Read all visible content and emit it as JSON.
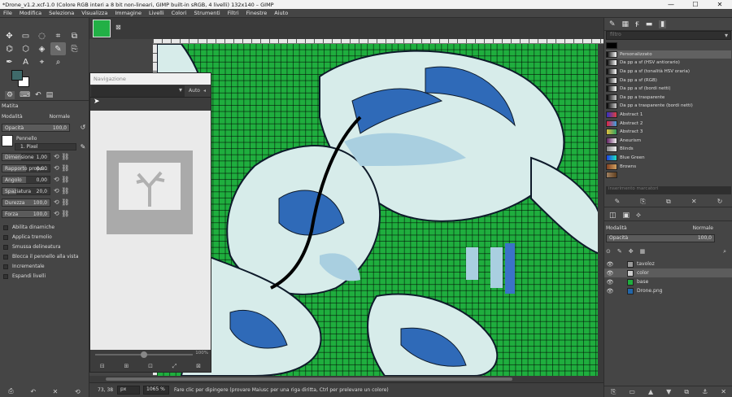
{
  "window": {
    "title": "*Drone_v1.2.xcf-1.0 (Colore RGB interi a 8 bit non-lineari, GIMP built-in sRGB, 4 livelli) 132x140 – GIMP",
    "minimize": "—",
    "maximize": "☐",
    "close": "✕"
  },
  "menu": [
    "File",
    "Modifica",
    "Seleziona",
    "Visualizza",
    "Immagine",
    "Livelli",
    "Colori",
    "Strumenti",
    "Filtri",
    "Finestre",
    "Aiuto"
  ],
  "colors": {
    "fg": "#3f6a6a",
    "bg": "#ffffff",
    "canvas": "#1fae3e"
  },
  "tool_options": {
    "title": "Matita",
    "mode_label": "Modalità",
    "mode_value": "Normale",
    "opacity_label": "Opacità",
    "opacity_value": "100,0",
    "brush_label": "Pennello",
    "brush_name": "1. Pixel",
    "params": [
      {
        "label": "Dimensione",
        "value": "1,00"
      },
      {
        "label": "Rapporto propo...",
        "value": "0,00"
      },
      {
        "label": "Angolo",
        "value": "0,00"
      },
      {
        "label": "Spaziatura",
        "value": "20,0"
      },
      {
        "label": "Durezza",
        "value": "100,0"
      },
      {
        "label": "Forza",
        "value": "100,0"
      }
    ],
    "checks": [
      "Abilita dinamiche",
      "Applica tremolio",
      "Smussa delineatura",
      "Blocca il pennello alla vista",
      "Incrementale",
      "Espandi livelli"
    ]
  },
  "navigation": {
    "title": "Navigazione",
    "auto_label": "Auto",
    "zoom_label": "100%"
  },
  "status": {
    "coords": "73, 38",
    "unit": "px",
    "zoom": "1065 %",
    "message": "Fare clic per dipingere (provare Maiusc per una riga diritta, Ctrl per prelevare un colore)"
  },
  "gradients": {
    "filter_placeholder": "filtro",
    "tags_placeholder": "inserimento marcatori",
    "items": [
      {
        "name": "",
        "colors": [
          "#000000",
          "#000000"
        ]
      },
      {
        "name": "Personalizzato",
        "colors": [
          "#000000",
          "#ffffff"
        ]
      },
      {
        "name": "Da pp a sf (HSV antiorario)",
        "colors": [
          "#000000",
          "#ffffff"
        ]
      },
      {
        "name": "Da pp a sf (tonalità HSV oraria)",
        "colors": [
          "#000000",
          "#ffffff"
        ]
      },
      {
        "name": "Da pp a sf (RGB)",
        "colors": [
          "#000000",
          "#ffffff"
        ]
      },
      {
        "name": "Da pp a sf (bordi netti)",
        "colors": [
          "#000000",
          "#ffffff"
        ]
      },
      {
        "name": "Da pp a trasparente",
        "colors": [
          "#000000",
          "#cccccc"
        ]
      },
      {
        "name": "Da pp a trasparente (bordi netti)",
        "colors": [
          "#000000",
          "#cccccc"
        ]
      },
      {
        "name": "Abstract 1",
        "colors": [
          "#3030c0",
          "#e04040"
        ]
      },
      {
        "name": "Abstract 2",
        "colors": [
          "#e02040",
          "#40a0e0"
        ]
      },
      {
        "name": "Abstract 3",
        "colors": [
          "#e0c040",
          "#30a060"
        ]
      },
      {
        "name": "Aneurism",
        "colors": [
          "#602060",
          "#f0f0f0"
        ]
      },
      {
        "name": "Blinds",
        "colors": [
          "#888888",
          "#eeeeee"
        ]
      },
      {
        "name": "Blue Green",
        "colors": [
          "#2040e0",
          "#20e0c0"
        ]
      },
      {
        "name": "Browns",
        "colors": [
          "#804020",
          "#d0a060"
        ]
      },
      {
        "name": "",
        "colors": [
          "#a08060",
          "#604020"
        ]
      }
    ]
  },
  "layers": {
    "mode_label": "Modalità",
    "mode_value": "Normale",
    "opacity_label": "Opacità",
    "opacity_value": "100,0",
    "items": [
      {
        "name": "tavoloz",
        "thumb": "#999999",
        "selected": false
      },
      {
        "name": "color",
        "thumb": "#cccccc",
        "selected": true
      },
      {
        "name": "base",
        "thumb": "#1fae3e",
        "selected": false
      },
      {
        "name": "Drone.png",
        "thumb": "#2266aa",
        "selected": false
      }
    ]
  }
}
